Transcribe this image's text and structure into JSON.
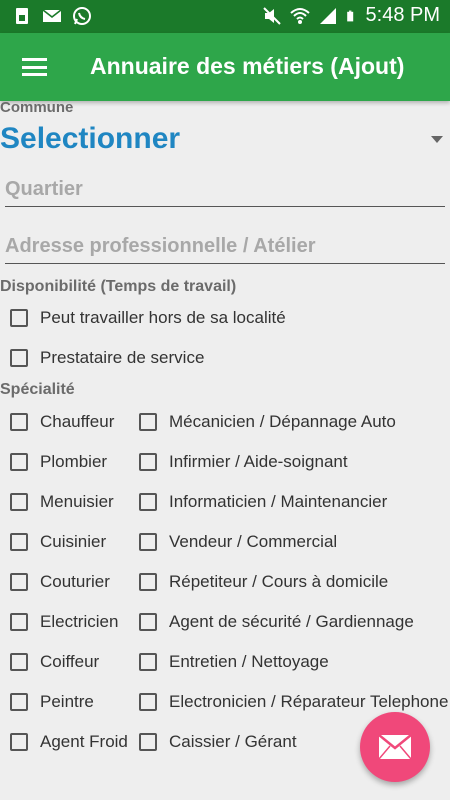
{
  "status_bar": {
    "time": "5:48 PM",
    "icons": [
      "sim-icon",
      "mail-icon",
      "whatsapp-icon",
      "mute-icon",
      "wifi-icon",
      "signal-icon",
      "battery-icon"
    ]
  },
  "app_bar": {
    "title": "Annuaire des métiers (Ajout)",
    "color": "#2ea64a"
  },
  "form": {
    "commune_label": "Commune",
    "commune_value": "Selectionner",
    "quartier_placeholder": "Quartier",
    "adresse_placeholder": "Adresse professionnelle / Atélier"
  },
  "disponibilite": {
    "title": "Disponibilité (Temps de travail)",
    "options": [
      "Peut travailler hors de sa localité",
      "Prestataire de service"
    ]
  },
  "specialite": {
    "title": "Spécialité",
    "left": [
      "Chauffeur",
      "Plombier",
      "Menuisier",
      "Cuisinier",
      "Couturier",
      "Electricien",
      "Coiffeur",
      "Peintre",
      "Agent Froid"
    ],
    "right": [
      "Mécanicien / Dépannage Auto",
      "Infirmier / Aide-soignant",
      "Informaticien / Maintenancier",
      "Vendeur / Commercial",
      "Répetiteur / Cours à domicile",
      "Agent de sécurité / Gardiennage",
      "Entretien / Nettoyage",
      "Electronicien / Réparateur Telephone",
      "Caissier / Gérant"
    ]
  },
  "fab": {
    "icon": "mail-icon",
    "color": "#f0487a"
  }
}
